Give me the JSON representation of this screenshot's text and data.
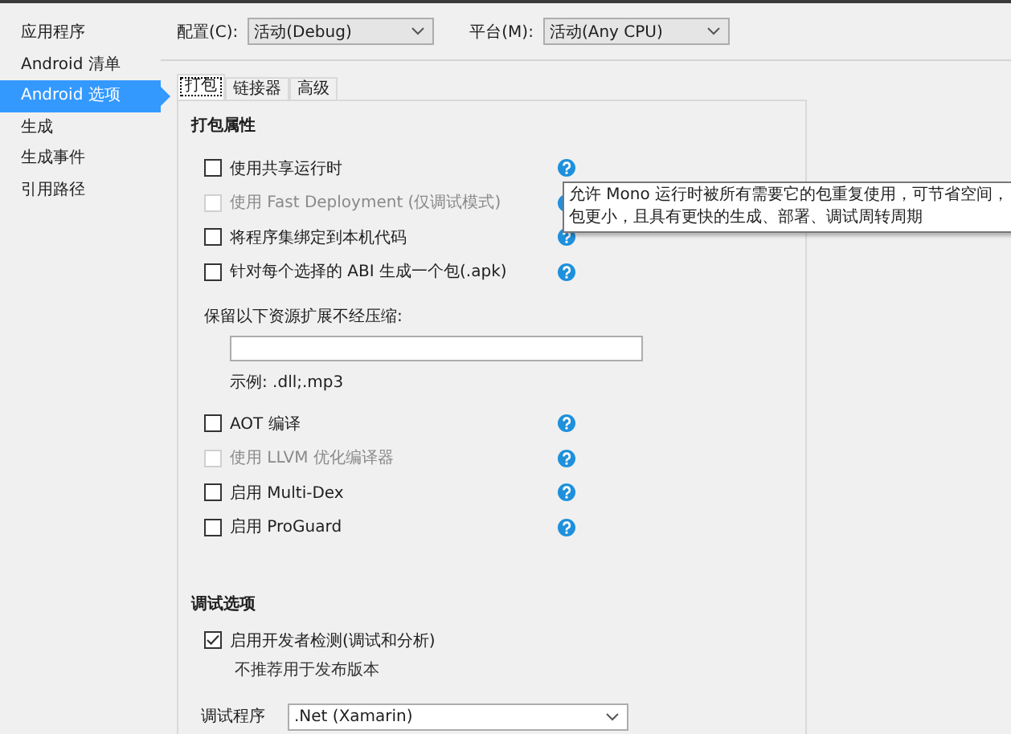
{
  "sidebar": {
    "items": [
      {
        "label": "应用程序",
        "selected": false
      },
      {
        "label": "Android 清单",
        "selected": false
      },
      {
        "label": "Android 选项",
        "selected": true
      },
      {
        "label": "生成",
        "selected": false
      },
      {
        "label": "生成事件",
        "selected": false
      },
      {
        "label": "引用路径",
        "selected": false
      }
    ]
  },
  "toolbar": {
    "configuration": {
      "label": "配置(C):",
      "value": "活动(Debug)"
    },
    "platform": {
      "label": "平台(M):",
      "value": "活动(Any CPU)"
    }
  },
  "tabs": [
    {
      "label": "打包",
      "selected": true
    },
    {
      "label": "链接器",
      "selected": false
    },
    {
      "label": "高级",
      "selected": false
    }
  ],
  "packaging": {
    "title": "打包属性",
    "items": [
      {
        "kind": "checkbox",
        "label": "使用共享运行时",
        "checked": false,
        "disabled": false
      },
      {
        "kind": "checkbox",
        "label": "使用 Fast Deployment (仅调试模式)",
        "checked": false,
        "disabled": true
      },
      {
        "kind": "checkbox",
        "label": "将程序集绑定到本机代码",
        "checked": false,
        "disabled": false
      },
      {
        "kind": "checkbox",
        "label": "针对每个选择的 ABI 生成一个包(.apk)",
        "checked": false,
        "disabled": false
      },
      {
        "kind": "textfield",
        "label": "保留以下资源扩展不经压缩:",
        "hint": "示例: .dll;.mp3"
      },
      {
        "kind": "checkbox",
        "label": "AOT 编译",
        "checked": false,
        "disabled": false
      },
      {
        "kind": "checkbox",
        "label": "使用 LLVM 优化编译器",
        "checked": false,
        "disabled": true
      },
      {
        "kind": "checkbox",
        "label": "启用 Multi-Dex",
        "checked": false,
        "disabled": false
      },
      {
        "kind": "checkbox",
        "label": "启用 ProGuard",
        "checked": false,
        "disabled": false
      }
    ]
  },
  "debugging": {
    "title": "调试选项",
    "option": {
      "label": "启用开发者检测(调试和分析)",
      "checked": true,
      "note": "不推荐用于发布版本"
    },
    "debugger": {
      "label": "调试程序",
      "value": ".Net (Xamarin)"
    }
  },
  "tooltip": {
    "lines": [
      "允许 Mono 运行时被所有需要它的包重复使用，可节省空间，",
      "包更小，且具有更快的生成、部署、调试周转周期"
    ]
  }
}
